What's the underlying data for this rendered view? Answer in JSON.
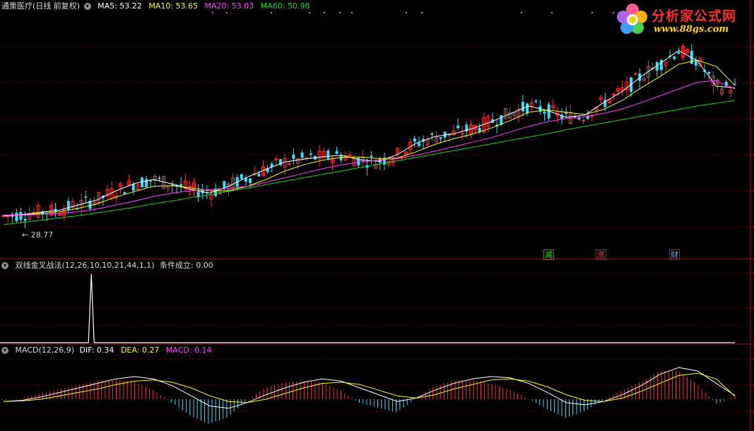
{
  "main_panel": {
    "stock_name": "通策医疗(日线 前复权)",
    "ma5": "MA5: 53.22",
    "ma10": "MA10: 53.65",
    "ma20": "MA20: 53.03",
    "ma60": "MA60: 50.98",
    "low_marker": "28.77",
    "tags": [
      "减",
      "涨",
      "财"
    ],
    "colors": {
      "ma5": "#ffffff",
      "ma10": "#ffff00",
      "ma20": "#ff40ff",
      "ma60": "#20d020",
      "up": "#ff3030",
      "down": "#30e0ff"
    }
  },
  "indicator_panel": {
    "title": "双线金叉战法(12,26,10,10,21,44,1,1)",
    "status": "条件成立: 0.00"
  },
  "macd_panel": {
    "title": "MACD(12,26,9)",
    "dif": "DIF: 0.34",
    "dea": "DEA: 0.27",
    "macd": "MACD: 0.14"
  },
  "logo": {
    "text": "分析家公式网",
    "url": "www.88gs.com"
  },
  "chart_data": [
    {
      "type": "line",
      "description_key": "price_ma",
      "series": [
        {
          "name": "MA5",
          "values": [
            30.5,
            30.8,
            31.2,
            31.6,
            32.5,
            33.4,
            35.0,
            36.3,
            37.0,
            36.2,
            35.2,
            34.6,
            35.8,
            37.4,
            38.8,
            40.1,
            40.6,
            41.0,
            41.3,
            40.5,
            40.2,
            41.4,
            43.4,
            44.6,
            45.1,
            46.0,
            47.2,
            48.6,
            50.0,
            49.2,
            48.0,
            48.4,
            50.6,
            52.6,
            55.2,
            57.5,
            59.8,
            58.0,
            53.5,
            53.2
          ]
        },
        {
          "name": "MA10",
          "values": [
            30.6,
            30.7,
            31.0,
            31.3,
            31.9,
            32.7,
            33.9,
            34.9,
            35.8,
            35.9,
            35.5,
            35.0,
            35.0,
            35.8,
            37.0,
            38.5,
            39.6,
            40.4,
            40.9,
            41.0,
            40.7,
            40.8,
            41.9,
            43.2,
            44.2,
            45.0,
            46.1,
            47.4,
            48.9,
            49.3,
            48.9,
            48.5,
            49.4,
            51.0,
            53.2,
            55.2,
            57.4,
            58.1,
            57.0,
            53.65
          ]
        },
        {
          "name": "MA20",
          "values": [
            30.7,
            30.7,
            30.8,
            31.0,
            31.3,
            31.8,
            32.5,
            33.2,
            34.0,
            34.6,
            35.0,
            35.2,
            35.4,
            35.8,
            36.5,
            37.3,
            38.1,
            38.9,
            39.6,
            40.1,
            40.4,
            40.7,
            41.3,
            42.0,
            42.8,
            43.6,
            44.4,
            45.4,
            46.4,
            47.2,
            47.8,
            48.1,
            48.7,
            49.5,
            50.6,
            51.8,
            53.0,
            54.2,
            54.5,
            53.03
          ]
        },
        {
          "name": "MA60",
          "values": [
            29.0,
            29.4,
            29.8,
            30.2,
            30.6,
            31.1,
            31.6,
            32.1,
            32.7,
            33.2,
            33.8,
            34.3,
            34.9,
            35.5,
            36.1,
            36.7,
            37.3,
            37.9,
            38.5,
            39.1,
            39.7,
            40.3,
            40.9,
            41.5,
            42.1,
            42.7,
            43.3,
            43.9,
            44.5,
            45.1,
            45.8,
            46.4,
            47.0,
            47.6,
            48.2,
            48.8,
            49.4,
            50.0,
            50.5,
            50.98
          ]
        }
      ],
      "low_marker": 28.77
    },
    {
      "type": "line",
      "description_key": "signal",
      "spike_position": 0.12,
      "spike_value": 1,
      "current": 0
    },
    {
      "type": "bar",
      "description_key": "macd",
      "dif": [
        -0.2,
        -0.1,
        0.2,
        0.6,
        1.0,
        1.4,
        1.8,
        2.0,
        1.8,
        1.2,
        0.3,
        -0.6,
        -0.8,
        -0.3,
        0.4,
        1.0,
        1.5,
        1.8,
        1.6,
        1.0,
        0.4,
        -0.2,
        0.1,
        0.8,
        1.4,
        1.8,
        2.0,
        1.9,
        1.4,
        0.6,
        -0.3,
        -0.5,
        -0.2,
        0.4,
        1.2,
        2.2,
        2.8,
        2.5,
        1.4,
        0.34
      ],
      "dea": [
        -0.2,
        -0.15,
        0.0,
        0.3,
        0.6,
        0.9,
        1.3,
        1.6,
        1.7,
        1.5,
        1.0,
        0.3,
        -0.2,
        -0.3,
        0.0,
        0.5,
        1.0,
        1.4,
        1.5,
        1.3,
        0.8,
        0.3,
        0.1,
        0.4,
        0.9,
        1.3,
        1.7,
        1.8,
        1.6,
        1.1,
        0.4,
        -0.1,
        -0.2,
        0.1,
        0.7,
        1.4,
        2.1,
        2.3,
        1.8,
        0.27
      ]
    }
  ]
}
